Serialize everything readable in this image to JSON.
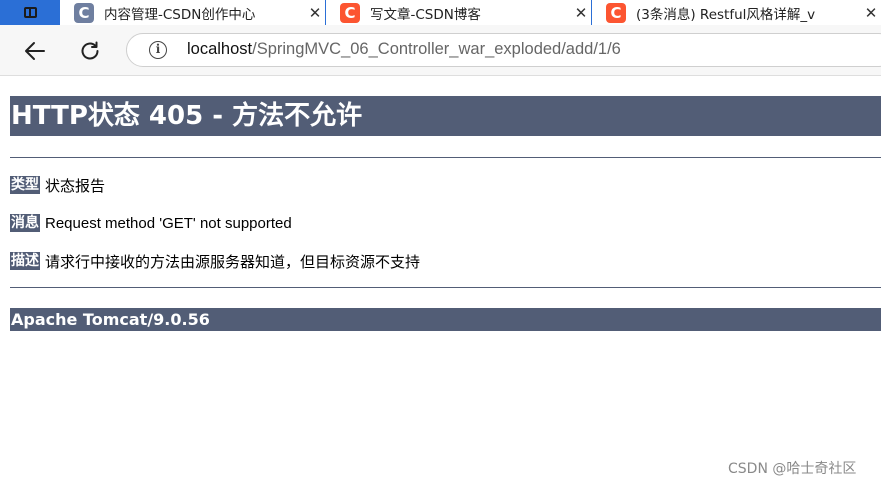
{
  "tabs": [
    {
      "title": "内容管理-CSDN创作中心",
      "favicon": "C",
      "favicon_color": "#6f7fa0"
    },
    {
      "title": "写文章-CSDN博客",
      "favicon": "C",
      "favicon_color": "#fc5531"
    },
    {
      "title": "(3条消息) Restful风格详解_v",
      "favicon": "C",
      "favicon_color": "#fc5531"
    }
  ],
  "tab_close_glyph": "✕",
  "navbar": {
    "url_host": "localhost",
    "url_path": "/SpringMVC_06_Controller_war_exploded/add/1/6"
  },
  "error_page": {
    "title": "HTTP状态 405 - 方法不允许",
    "rows": [
      {
        "label": "类型",
        "value": "状态报告"
      },
      {
        "label": "消息",
        "value": "Request method 'GET' not supported"
      },
      {
        "label": "描述",
        "value": "请求行中接收的方法由源服务器知道，但目标资源不支持"
      }
    ],
    "footer": "Apache Tomcat/9.0.56"
  },
  "watermark": "CSDN @哈士奇社区",
  "colors": {
    "header_bg": "#525d76",
    "tabbar_bg": "#2b6fd6"
  }
}
